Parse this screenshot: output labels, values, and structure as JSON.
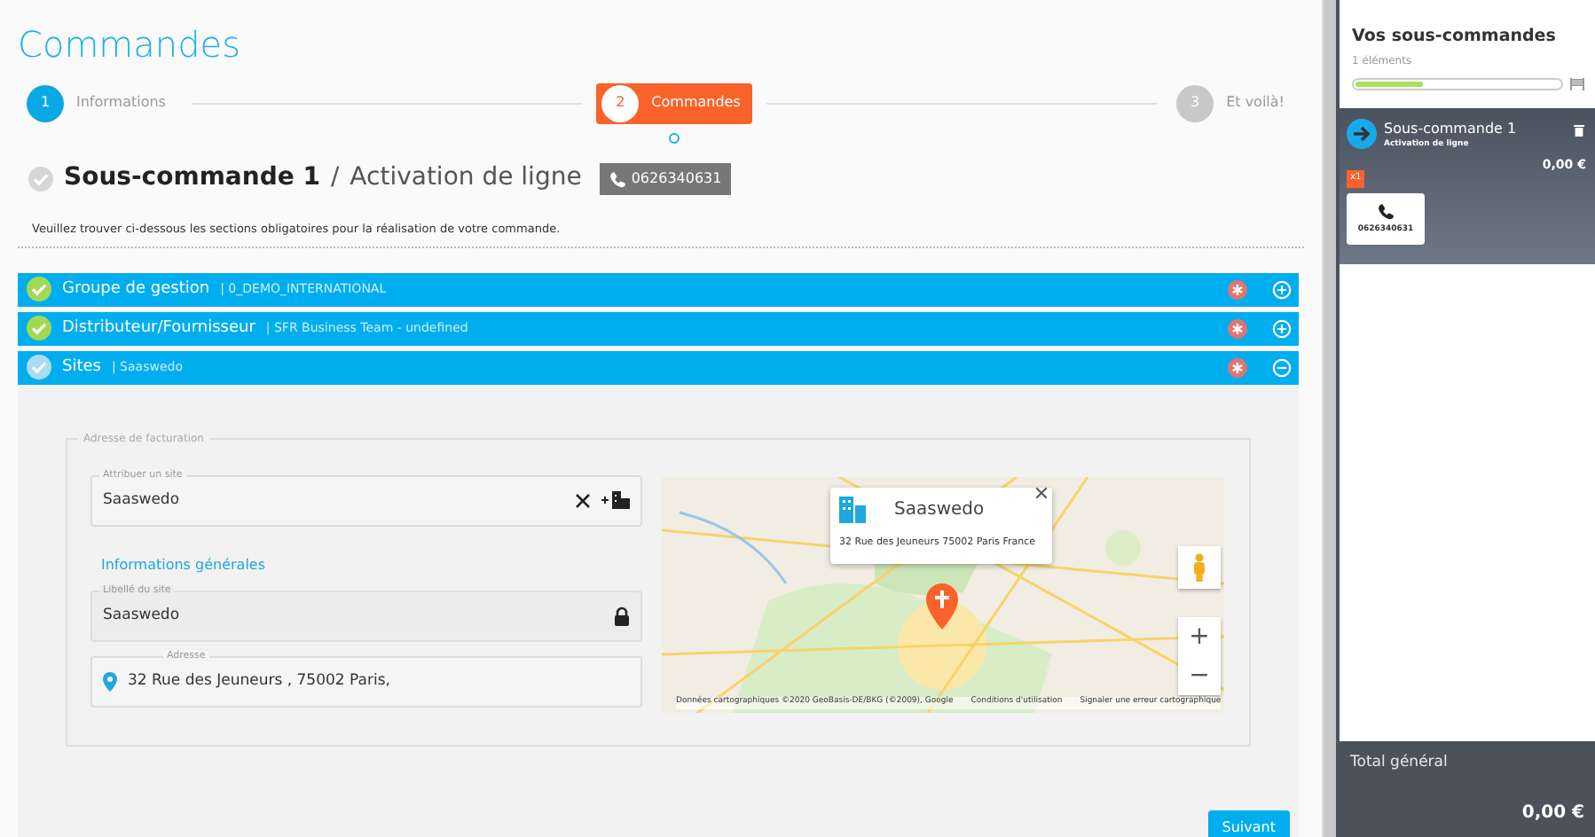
{
  "page_title": "Commandes",
  "steps": [
    {
      "number": "1",
      "label": "Informations",
      "selected": false,
      "completed": true
    },
    {
      "number": "2",
      "label": "Commandes",
      "selected": true,
      "completed": false
    },
    {
      "number": "3",
      "label": "Et voilà!",
      "selected": false,
      "completed": false
    }
  ],
  "suborder": {
    "title": "Sous-commande 1",
    "separator": "/",
    "subtitle": "Activation de ligne",
    "phone": "0626340631",
    "complete": false
  },
  "instructions": "Veuillez trouver ci-dessous les sections obligatoires pour la réalisation de votre commande.",
  "sections": [
    {
      "label": "Groupe de gestion",
      "detail": "| 0_DEMO_INTERNATIONAL",
      "complete": true,
      "expanded": false
    },
    {
      "label": "Distributeur/Fournisseur",
      "detail": "| SFR Business Team - undefined",
      "complete": true,
      "expanded": false
    },
    {
      "label": "Sites",
      "detail": "| Saaswedo",
      "complete": false,
      "expanded": true
    }
  ],
  "billing": {
    "legend": "Adresse de facturation",
    "site_field": {
      "label": "Attribuer un site",
      "value": "Saaswedo"
    },
    "general_heading": "Informations générales",
    "name_field": {
      "label": "Libellé du site",
      "value": "Saaswedo",
      "locked": true
    },
    "address_field": {
      "label": "Adresse",
      "value": "32 Rue des Jeuneurs  , 75002 Paris,"
    },
    "map": {
      "popup_title": "Saaswedo",
      "popup_address": "32 Rue des Jeuneurs 75002 Paris France",
      "zoom_in": "+",
      "zoom_out": "−",
      "attribution": [
        "Données cartographiques ©2020 GeoBasis-DE/BKG (©2009), Google",
        "Conditions d'utilisation",
        "Signaler une erreur cartographique"
      ]
    }
  },
  "next_button": "Suivant",
  "sidebar": {
    "title": "Vos sous-commandes",
    "count": "1 éléments",
    "progress": {
      "level": 0.33
    },
    "orders": [
      {
        "title": "Sous-commande 1",
        "subtitle": "Activation de ligne",
        "price": "0,00 €",
        "quantity": "x1",
        "line": "0626340631"
      }
    ],
    "total_label": "Total général",
    "total": "0,00 €"
  }
}
